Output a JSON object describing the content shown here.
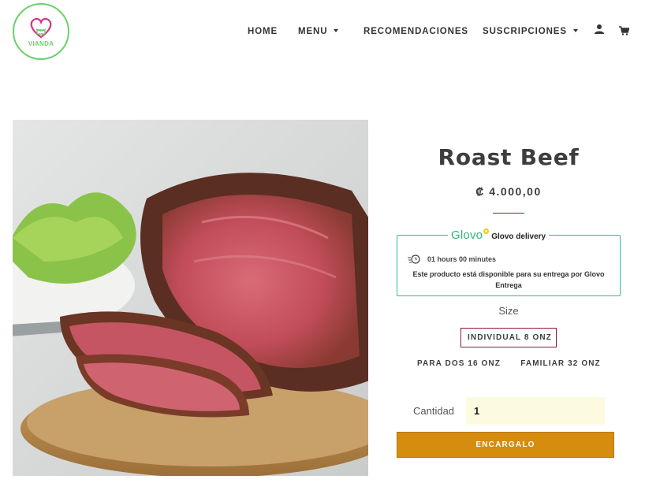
{
  "brand": {
    "name": "VIANDA",
    "primary_color": "#6dd06a",
    "heart_color": "#d6338a"
  },
  "nav": {
    "items": [
      {
        "label": "HOME",
        "has_dropdown": false
      },
      {
        "label": "MENU",
        "has_dropdown": true
      },
      {
        "label": "RECOMENDACIONES",
        "has_dropdown": false
      },
      {
        "label": "SUSCRIPCIONES",
        "has_dropdown": true
      }
    ],
    "icons": [
      "user-icon",
      "cart-icon"
    ]
  },
  "product": {
    "title": "Roast Beef",
    "price": "₡ 4.000,00",
    "image": "roast-beef-on-wooden-board-photo",
    "accent_color": "#8b1a2b"
  },
  "glovo": {
    "brand": "Glovo",
    "label": "Glovo delivery",
    "time": "01 hours 00 minutes",
    "note": "Este producto está disponible para su entrega por Glovo Entrega",
    "border_color": "#33b8a3"
  },
  "options": {
    "size_label": "Size",
    "sizes": [
      "INDIVIDUAL 8 ONZ",
      "PARA DOS 16 ONZ",
      "FAMILIAR 32 ONZ"
    ],
    "selected": "INDIVIDUAL 8 ONZ"
  },
  "quantity": {
    "label": "Cantidad",
    "value": "1"
  },
  "buy_button": {
    "label": "ENCARGALO",
    "color": "#d58c0f"
  }
}
